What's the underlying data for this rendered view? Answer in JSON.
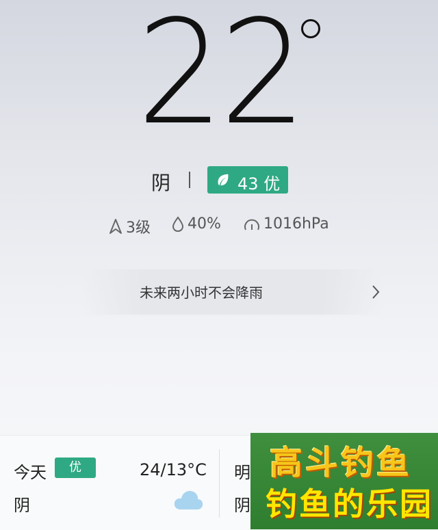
{
  "current": {
    "temperature": "22",
    "condition": "阴",
    "aqi_value": "43",
    "aqi_level": "优",
    "aqi_color": "#2fa983"
  },
  "metrics": {
    "wind": "3级",
    "humidity": "40%",
    "pressure": "1016hPa"
  },
  "rain_forecast": {
    "text": "未来两小时不会降雨"
  },
  "forecast": {
    "today": {
      "label": "今天",
      "aqi_level": "优",
      "temp_range": "24/13°C",
      "condition": "阴",
      "icon": "cloud-icon"
    },
    "tomorrow": {
      "label": "明",
      "condition": "阴"
    }
  },
  "ad": {
    "line1": "高斗钓鱼",
    "line2": "钓鱼的乐园"
  }
}
